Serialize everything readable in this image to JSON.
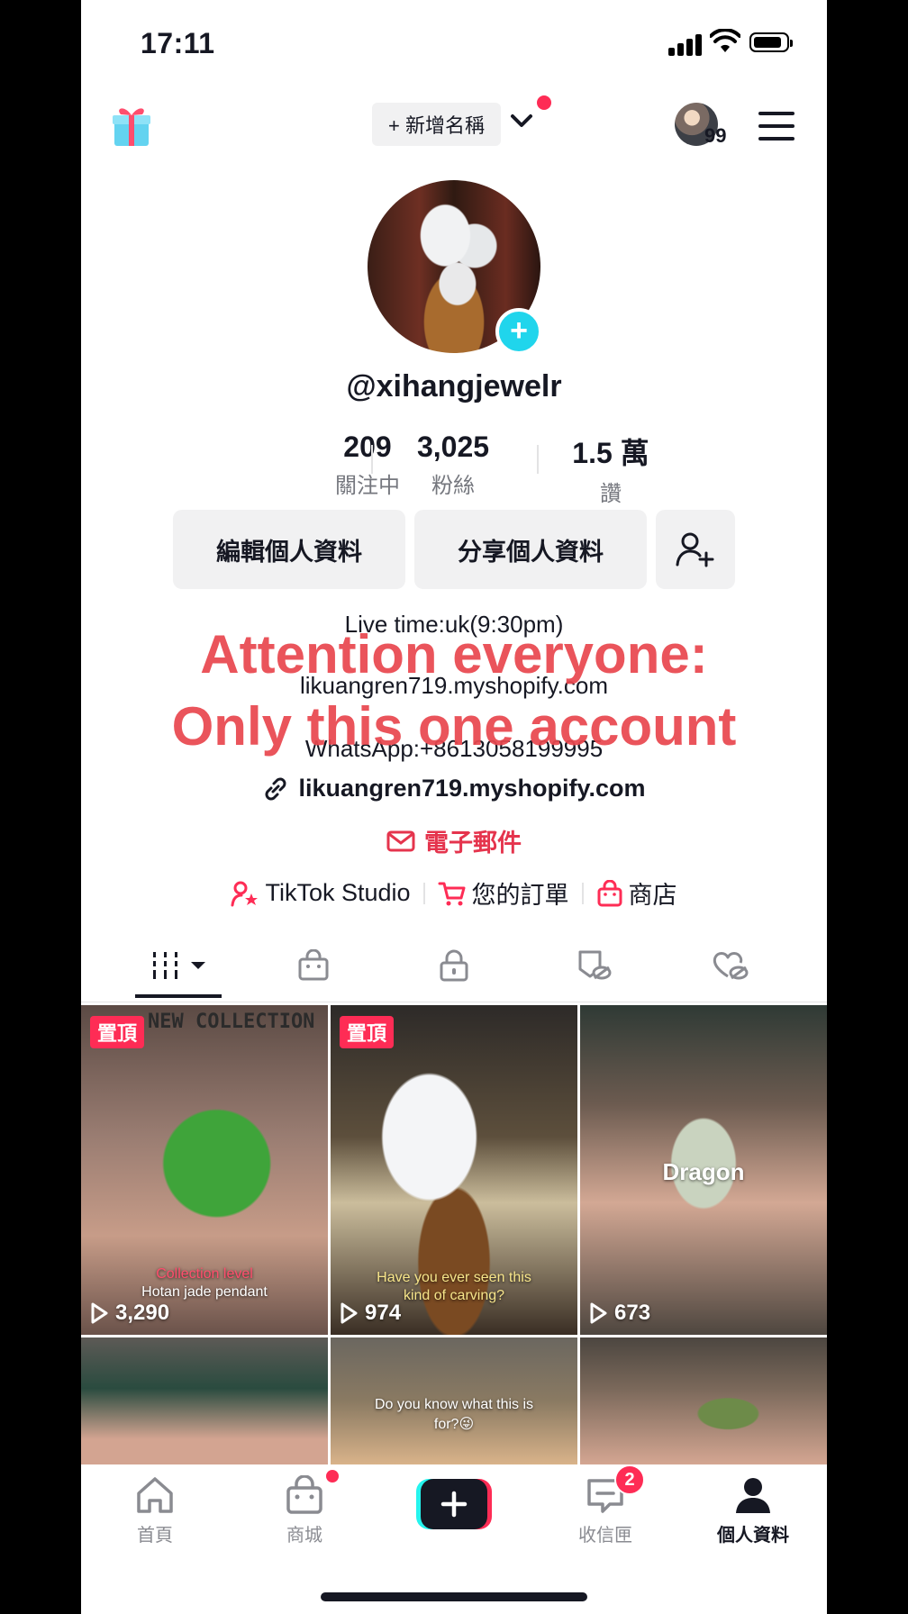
{
  "status_bar": {
    "time": "17:11"
  },
  "header": {
    "add_name_label": "+ 新增名稱",
    "badge_count": "99"
  },
  "profile": {
    "username": "@xihangjewelr",
    "stats": [
      {
        "value": "209",
        "label": "關注中"
      },
      {
        "value": "3,025",
        "label": "粉絲"
      },
      {
        "value": "1.5 萬",
        "label": "讚"
      }
    ],
    "edit_profile_label": "編輯個人資料",
    "share_profile_label": "分享個人資料"
  },
  "bio": {
    "line1": "Live time:uk(9:30pm)",
    "line2": "likuangren719.myshopify.com",
    "line3": "WhatsApp:+8613058199995",
    "overlay_line1": "Attention everyone:",
    "overlay_line2": "Only this one account",
    "link": "likuangren719.myshopify.com",
    "email_label": "電子郵件"
  },
  "tools": {
    "studio": "TikTok Studio",
    "orders": "您的訂單",
    "shop": "商店"
  },
  "videos": [
    {
      "pinned": "置頂",
      "plays": "3,290",
      "overlay_top": "NEW COLLECTION",
      "caption1": "Collection level",
      "caption2": "Hotan jade pendant"
    },
    {
      "pinned": "置頂",
      "plays": "974",
      "caption1": "Have you ever seen this",
      "caption2": "kind of carving?"
    },
    {
      "plays": "673",
      "overlay_center": "Dragon"
    },
    {},
    {
      "caption1": "Do you know what this is",
      "caption2": "for?😜"
    },
    {}
  ],
  "bottom_nav": {
    "home": "首頁",
    "mall": "商城",
    "inbox": "收信匣",
    "inbox_badge": "2",
    "profile": "個人資料"
  },
  "colors": {
    "accent": "#fe2c55",
    "cyan": "#20d5ec",
    "overlay_red": "#e9484f"
  }
}
